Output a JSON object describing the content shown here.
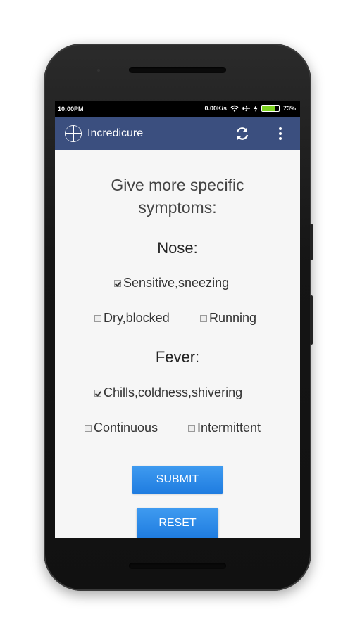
{
  "status_bar": {
    "time": "10:00PM",
    "network_speed": "0.00K/s",
    "battery": "73%",
    "battery_level": 0.73
  },
  "app_bar": {
    "title": "Incredicure",
    "icons": [
      "app-logo-icon",
      "refresh-icon",
      "overflow-menu-icon"
    ]
  },
  "form": {
    "heading_line1": "Give more specific",
    "heading_line2": "symptoms:",
    "sections": [
      {
        "title": "Nose:",
        "options": [
          {
            "label": "Sensitive,sneezing",
            "checked": true
          },
          {
            "label": "Dry,blocked",
            "checked": false
          },
          {
            "label": "Running",
            "checked": false
          }
        ]
      },
      {
        "title": "Fever:",
        "options": [
          {
            "label": "Chills,coldness,shivering",
            "checked": true
          },
          {
            "label": "Continuous",
            "checked": false
          },
          {
            "label": "Intermittent",
            "checked": false
          }
        ]
      }
    ],
    "submit_label": "SUBMIT",
    "reset_label": "RESET"
  },
  "colors": {
    "app_bar": "#3b4f7f",
    "button": "#2585e6",
    "screen_bg": "#f6f6f6"
  }
}
